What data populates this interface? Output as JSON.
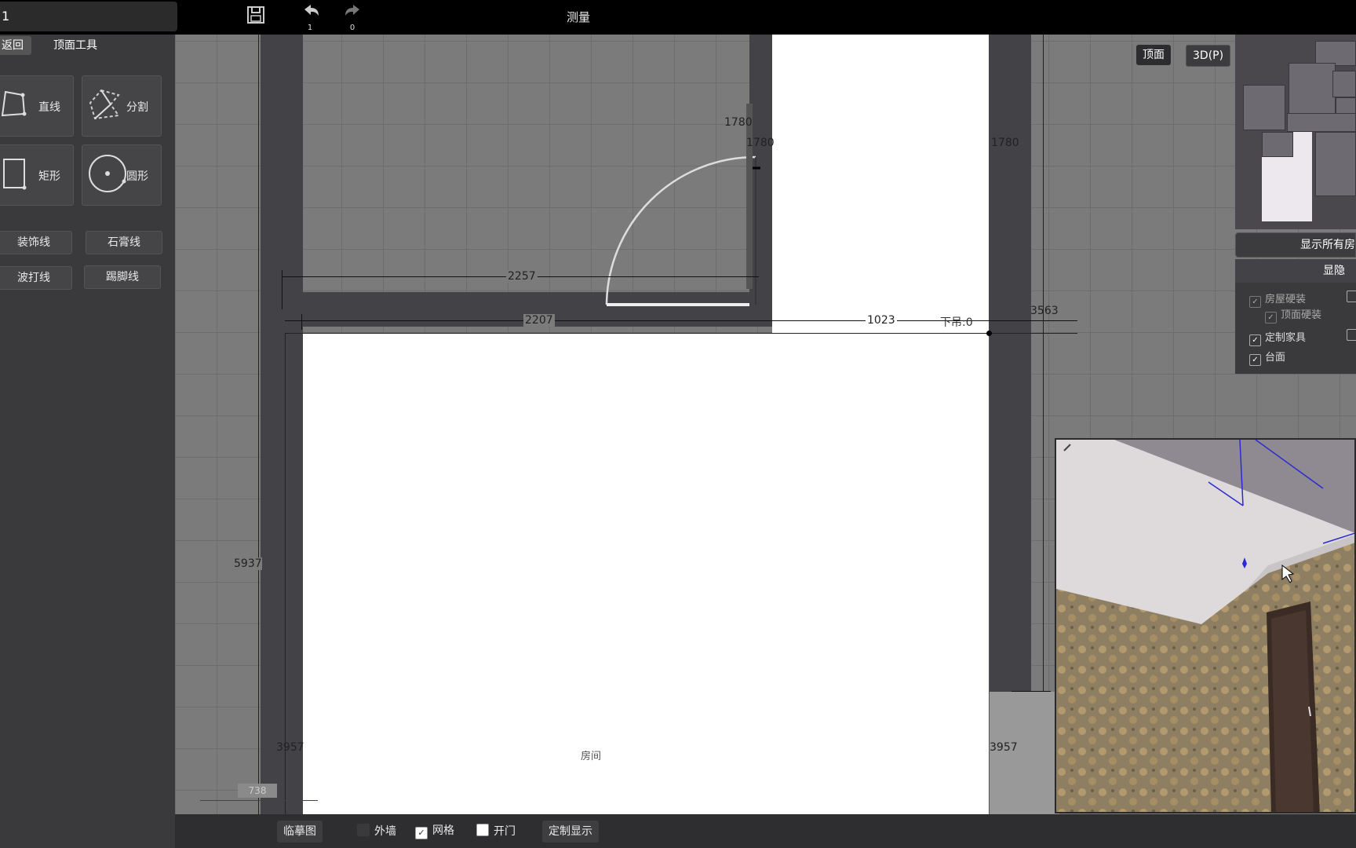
{
  "topbar": {
    "project_name": "1",
    "undo_count": "1",
    "redo_count": "0",
    "title": "测量",
    "icons": [
      "save-icon",
      "undo-icon",
      "redo-icon"
    ]
  },
  "leftpanel": {
    "tabs": [
      {
        "label": "返回"
      },
      {
        "label": "顶面工具"
      }
    ],
    "tools": [
      {
        "label": "直线",
        "icon": "polyline-icon"
      },
      {
        "label": "分割",
        "icon": "split-icon"
      },
      {
        "label": "矩形",
        "icon": "rectangle-icon"
      },
      {
        "label": "圆形",
        "icon": "circle-icon"
      }
    ],
    "buttons": [
      {
        "label": "装饰线"
      },
      {
        "label": "石膏线"
      },
      {
        "label": "波打线"
      },
      {
        "label": "踢脚线"
      }
    ]
  },
  "canvas": {
    "dims": {
      "d1780a": "1780",
      "d1780b": "1780",
      "d1780c": "1780",
      "d2257": "2257",
      "d2207": "2207",
      "d1023": "1023",
      "d3563": "3563",
      "d5937": "5937",
      "d3957a": "3957",
      "d3957b": "3957",
      "d738": "738"
    },
    "ceiling_label": "下吊:0",
    "room_label": "房间"
  },
  "viewbuttons": {
    "top": "顶面",
    "three_d": "3D(P)"
  },
  "rightpanel": {
    "show_all_rooms": "显示所有房",
    "visibility_title": "显隐",
    "items": [
      {
        "label": "房屋硬装",
        "checked": true,
        "disabled": true
      },
      {
        "label": "顶面硬装",
        "checked": true,
        "disabled": true
      },
      {
        "label": "定制家具",
        "checked": true,
        "disabled": false
      },
      {
        "label": "台面",
        "checked": true,
        "disabled": false
      }
    ]
  },
  "bottombar": {
    "trace_label": "临摹图",
    "outer_wall": {
      "label": "外墙",
      "checked": false
    },
    "grid": {
      "label": "网格",
      "checked": true
    },
    "open_door": {
      "label": "开门",
      "checked": false
    },
    "custom_display": "定制显示"
  },
  "colors": {
    "wall": "#434246",
    "panel": "#3a3a3c",
    "topbar": "#000000",
    "room_fill": "#ffffff"
  }
}
